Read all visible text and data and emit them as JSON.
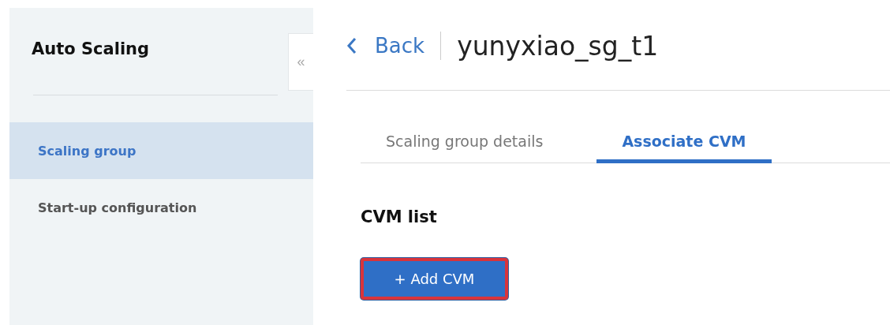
{
  "sidebar": {
    "title": "Auto Scaling",
    "collapse_button": "«",
    "items": [
      {
        "label": "Scaling group",
        "selected": true
      },
      {
        "label": "Start-up configuration",
        "selected": false
      }
    ]
  },
  "header": {
    "back": "Back",
    "title": "yunyxiao_sg_t1"
  },
  "tabs": [
    {
      "label": "Scaling group details",
      "selected": false
    },
    {
      "label": "Associate CVM",
      "selected": true
    }
  ],
  "section": {
    "title": "CVM list",
    "button": "+ Add CVM"
  }
}
